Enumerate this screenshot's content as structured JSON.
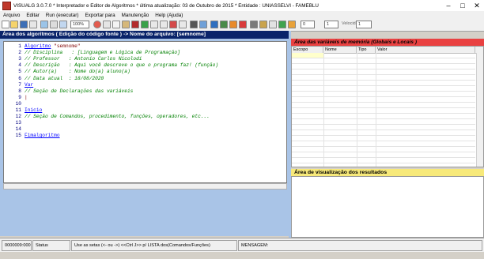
{
  "window": {
    "title": "VISUALG 3.0.7.0 * Interpretador e Editor de Algoritmos * última atualização: 03 de Outubro de 2015 * Entidade : UNIASSELVI - FAMEBLU",
    "minimize": "–",
    "maximize": "□",
    "close": "✕"
  },
  "menu": [
    "Arquivo",
    "Editar",
    "Run (executar)",
    "Exportar para",
    "Manutenção",
    "Help (Ajuda)"
  ],
  "toolbar": {
    "zoom_value": "100%",
    "speed_value": "0",
    "step_value": "1",
    "label_speed": "Velocidade"
  },
  "editor": {
    "header": "Área dos algoritmos ( Edição do código fonte ) -> Nome do arquivo: [semnome]",
    "lines": [
      {
        "n": "1",
        "parts": [
          {
            "t": "Algoritmo",
            "c": "kw"
          },
          {
            "t": " \"semnome\"",
            "c": "st"
          }
        ]
      },
      {
        "n": "2",
        "parts": [
          {
            "t": "// Disciplina   : [Linguagem e Lógica de Programação]",
            "c": "cm"
          }
        ]
      },
      {
        "n": "3",
        "parts": [
          {
            "t": "// Professor   : Antonio Carlos Nicolodi",
            "c": "cm"
          }
        ]
      },
      {
        "n": "4",
        "parts": [
          {
            "t": "// Descrição   : Aqui você descreve o que o programa faz! (função)",
            "c": "cm"
          }
        ]
      },
      {
        "n": "5",
        "parts": [
          {
            "t": "// Autor(a)    : Nome do(a) aluno(a)",
            "c": "cm"
          }
        ]
      },
      {
        "n": "6",
        "parts": [
          {
            "t": "// Data atual  : 18/08/2020",
            "c": "cm"
          }
        ]
      },
      {
        "n": "7",
        "parts": [
          {
            "t": "Var",
            "c": "kw"
          }
        ]
      },
      {
        "n": "8",
        "parts": [
          {
            "t": "// Seção de Declarações das variáveis",
            "c": "cm"
          }
        ]
      },
      {
        "n": "9",
        "parts": [
          {
            "t": "|",
            "c": "st"
          }
        ]
      },
      {
        "n": "10",
        "parts": []
      },
      {
        "n": "11",
        "parts": [
          {
            "t": "Inicio",
            "c": "kw"
          }
        ]
      },
      {
        "n": "12",
        "parts": [
          {
            "t": "// Seção de Comandos, procedimento, funções, operadores, etc...",
            "c": "cm"
          }
        ]
      },
      {
        "n": "13",
        "parts": []
      },
      {
        "n": "14",
        "parts": []
      },
      {
        "n": "15",
        "parts": [
          {
            "t": "Fimalgoritmo",
            "c": "kw"
          }
        ]
      }
    ]
  },
  "variables": {
    "header": "Área das variáveis de memória (Globais e Locais )",
    "columns": [
      "Escopo",
      "Nome",
      "Tipo",
      "Valor"
    ]
  },
  "results": {
    "header": "Área de visualização dos resultados"
  },
  "status": {
    "position": "0000009:0001",
    "status_label": "Status",
    "hint": "Use as setas (<- ou ->) <<Ctrl J>> p/ LISTA dos(Comandos/Funções)",
    "message_label": "MENSAGEM:"
  },
  "colors": {
    "editor_header_bg": "#0a246a",
    "panel_bg": "#a9c4e7",
    "var_header_bg": "#e94141",
    "result_header_bg": "#f7e97a"
  }
}
